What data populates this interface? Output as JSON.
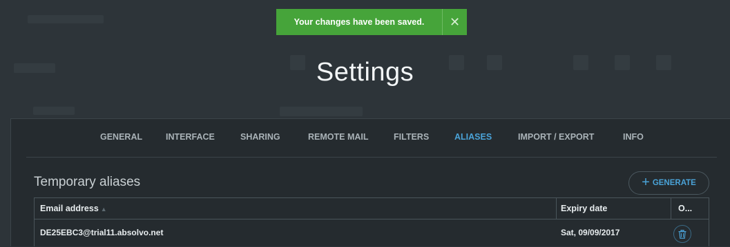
{
  "toast": {
    "message": "Your changes have been saved.",
    "close_glyph": "✕",
    "color": "#46a43a"
  },
  "modal": {
    "title": "Settings",
    "tabs": [
      {
        "label": "GENERAL",
        "active": false
      },
      {
        "label": "INTERFACE",
        "active": false
      },
      {
        "label": "SHARING",
        "active": false
      },
      {
        "label": "REMOTE MAIL",
        "active": false
      },
      {
        "label": "FILTERS",
        "active": false
      },
      {
        "label": "ALIASES",
        "active": true
      },
      {
        "label": "IMPORT / EXPORT",
        "active": false
      },
      {
        "label": "INFO",
        "active": false
      }
    ],
    "active_color": "#4aa3d8"
  },
  "aliases": {
    "section_title": "Temporary aliases",
    "generate_label": "GENERATE",
    "generate_icon": "plus-icon",
    "columns": {
      "email": "Email address",
      "expiry": "Expiry date",
      "options": "O..."
    },
    "rows": [
      {
        "email": "DE25EBC3@trial11.absolvo.net",
        "expiry": "Sat, 09/09/2017",
        "action_icon": "trash-icon"
      }
    ]
  }
}
